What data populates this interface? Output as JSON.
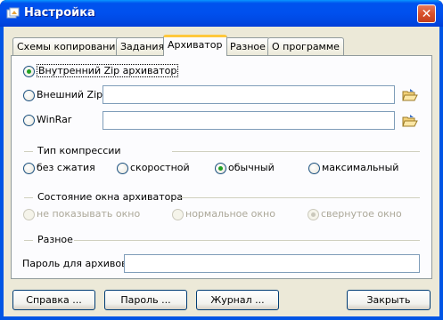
{
  "window": {
    "title": "Настройка",
    "close_glyph": "✕"
  },
  "tabs": [
    {
      "label": "Схемы копирования"
    },
    {
      "label": "Задания"
    },
    {
      "label": "Архиватор"
    },
    {
      "label": "Разное"
    },
    {
      "label": "О программе"
    }
  ],
  "archiver": {
    "internal_zip": "Внутренний Zip архиватор",
    "external_zip": "Внешний Zip",
    "external_zip_path": "",
    "winrar": "WinRar",
    "winrar_path": "",
    "selected": "internal_zip"
  },
  "compression": {
    "heading": "Тип компрессии",
    "options": [
      "без сжатия",
      "скоростной",
      "обычный",
      "максимальный"
    ],
    "selected": "обычный"
  },
  "window_state": {
    "heading": "Состояние окна архиватора",
    "options": [
      "не показывать окно",
      "нормальное окно",
      "свернутое окно"
    ],
    "selected": "свернутое окно"
  },
  "misc": {
    "heading": "Разное",
    "password_label": "Пароль для архивов",
    "password_value": ""
  },
  "buttons": {
    "help": "Справка ...",
    "password": "Пароль ...",
    "journal": "Журнал ...",
    "close": "Закрыть"
  },
  "colors": {
    "title_bar": "#0054e3",
    "dialog_bg": "#ece9d8",
    "check_green": "#21a121",
    "tab_highlight": "#ffc83c"
  }
}
